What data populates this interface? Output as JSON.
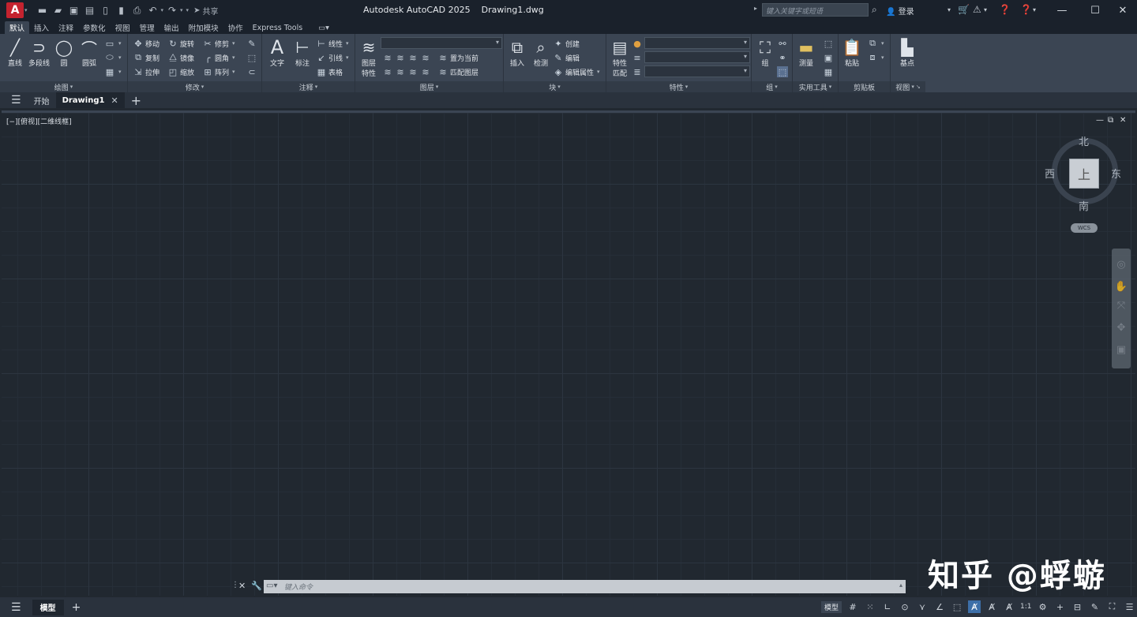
{
  "app": {
    "logo": "A",
    "title": "Autodesk AutoCAD 2025",
    "document": "Drawing1.dwg",
    "share": "共享",
    "search_placeholder": "键入关键字或短语",
    "login": "登录"
  },
  "quick_access": [
    "new-icon",
    "open-icon",
    "save-icon",
    "saveas-icon",
    "publish-icon",
    "plot-icon",
    "print-icon",
    "undo-icon",
    "redo-icon"
  ],
  "ribbon_tabs": [
    "默认",
    "插入",
    "注释",
    "参数化",
    "视图",
    "管理",
    "输出",
    "附加模块",
    "协作",
    "Express Tools"
  ],
  "ribbon": {
    "draw": {
      "label": "绘图",
      "line": "直线",
      "polyline": "多段线",
      "circle": "圆",
      "arc": "圆弧"
    },
    "modify": {
      "label": "修改",
      "move": "移动",
      "rotate": "旋转",
      "trim": "修剪",
      "copy": "复制",
      "mirror": "镜像",
      "fillet": "圆角",
      "stretch": "拉伸",
      "scale": "缩放",
      "array": "阵列"
    },
    "annotation": {
      "label": "注释",
      "text": "文字",
      "dimension": "标注",
      "linear": "线性",
      "leader": "引线",
      "table": "表格"
    },
    "layers": {
      "label": "图层",
      "properties_l1": "图层",
      "properties_l2": "特性",
      "set_current": "置为当前",
      "match_layer": "匹配图层"
    },
    "block": {
      "label": "块",
      "insert": "插入",
      "detect": "检测",
      "create": "创建",
      "edit": "编辑",
      "edit_attributes": "编辑属性"
    },
    "properties": {
      "label": "特性",
      "match_l1": "特性",
      "match_l2": "匹配"
    },
    "groups": {
      "label": "组",
      "group": "组"
    },
    "utilities": {
      "label": "实用工具",
      "measure": "测量"
    },
    "clipboard": {
      "label": "剪贴板",
      "paste": "粘贴"
    },
    "view": {
      "label": "视图",
      "base": "基点"
    }
  },
  "doc_tabs": {
    "start": "开始",
    "active": "Drawing1"
  },
  "viewport": {
    "label": "[−][俯视][二维线框]"
  },
  "viewcube": {
    "north": "北",
    "south": "南",
    "east": "东",
    "west": "西",
    "face": "上",
    "wcs": "WCS"
  },
  "command_line": {
    "placeholder": "键入命令"
  },
  "watermark": "知乎 @蜉蝣",
  "status": {
    "model_tab": "模型",
    "model_mode": "模型",
    "scale": "1:1"
  },
  "colors": {
    "background": "#212830",
    "ribbon": "#3b4553",
    "titlebar": "#1a212b",
    "accent": "#c4232f",
    "status_active": "#3d6fa8"
  }
}
